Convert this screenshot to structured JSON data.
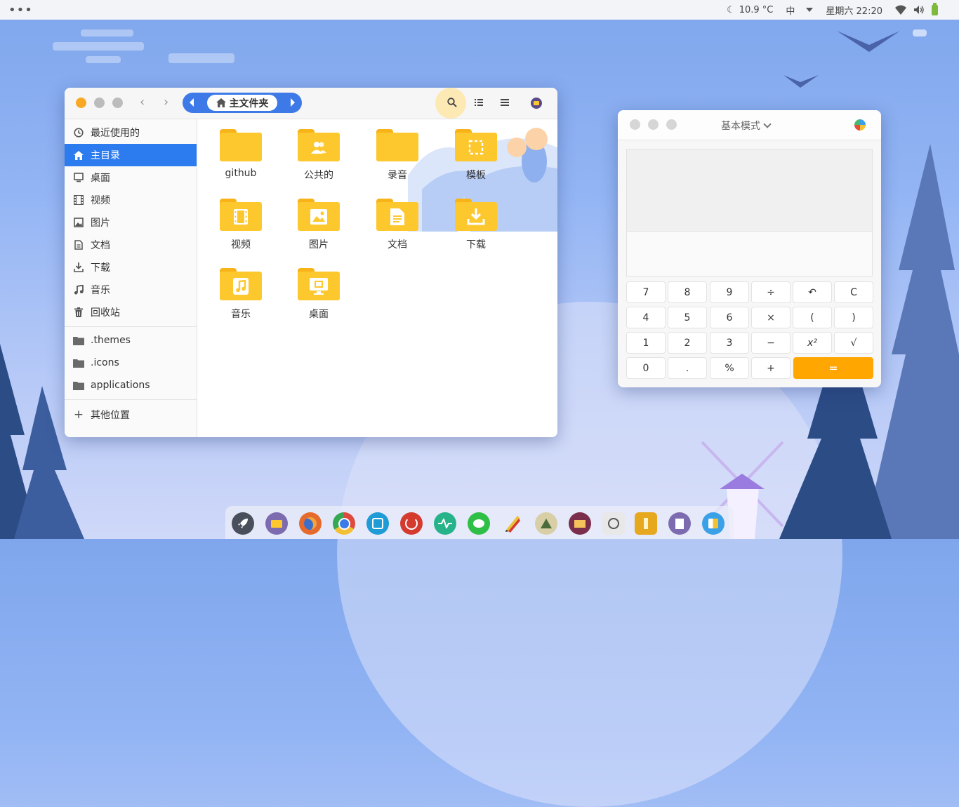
{
  "topbar": {
    "menu_dots": "•••",
    "weather": "10.9 °C",
    "input_method": "中",
    "datetime": "星期六 22:20"
  },
  "file_manager": {
    "path_crumb": "主文件夹",
    "sidebar": {
      "items": [
        {
          "label": "最近使用的",
          "icon": "clock-icon"
        },
        {
          "label": "主目录",
          "icon": "home-icon",
          "active": true
        },
        {
          "label": "桌面",
          "icon": "desktop-icon"
        },
        {
          "label": "视频",
          "icon": "film-icon"
        },
        {
          "label": "图片",
          "icon": "image-icon"
        },
        {
          "label": "文档",
          "icon": "document-icon"
        },
        {
          "label": "下载",
          "icon": "download-icon"
        },
        {
          "label": "音乐",
          "icon": "music-icon"
        },
        {
          "label": "回收站",
          "icon": "trash-icon"
        }
      ],
      "bookmarks": [
        ".themes",
        ".icons",
        "applications"
      ],
      "other_locations": "其他位置",
      "add_symbol": "+"
    },
    "folders": [
      {
        "label": "github",
        "icon": "folder-icon"
      },
      {
        "label": "公共的",
        "icon": "folder-users-icon"
      },
      {
        "label": "录音",
        "icon": "folder-icon"
      },
      {
        "label": "模板",
        "icon": "folder-template-icon"
      },
      {
        "label": "视频",
        "icon": "folder-video-icon"
      },
      {
        "label": "图片",
        "icon": "folder-pictures-icon"
      },
      {
        "label": "文档",
        "icon": "folder-documents-icon"
      },
      {
        "label": "下载",
        "icon": "folder-download-icon"
      },
      {
        "label": "音乐",
        "icon": "folder-music-icon"
      },
      {
        "label": "桌面",
        "icon": "folder-desktop-icon"
      }
    ]
  },
  "calculator": {
    "mode": "基本模式",
    "keys": [
      [
        "7",
        "8",
        "9",
        "÷",
        "↶",
        "C"
      ],
      [
        "4",
        "5",
        "6",
        "×",
        "(",
        ")"
      ],
      [
        "1",
        "2",
        "3",
        "−",
        "x²",
        "√"
      ],
      [
        "0",
        ".",
        "%",
        "+",
        "="
      ]
    ]
  },
  "dock": {
    "apps": [
      {
        "name": "launcher",
        "color": "#4a4f5c"
      },
      {
        "name": "files",
        "color": "#7d6bb0"
      },
      {
        "name": "firefox",
        "color": "#e66a2c"
      },
      {
        "name": "chrome",
        "color": "#dd4b3e"
      },
      {
        "name": "screenshot",
        "color": "#1f9bd6"
      },
      {
        "name": "netease-music",
        "color": "#d53a2f"
      },
      {
        "name": "system-monitor",
        "color": "#26b38a"
      },
      {
        "name": "wechat",
        "color": "#2fbf46"
      },
      {
        "name": "pencil",
        "color": "#e9c23a"
      },
      {
        "name": "inkscape",
        "color": "#d8cfa6"
      },
      {
        "name": "mail",
        "color": "#7b2e4c"
      },
      {
        "name": "recorder",
        "color": "#c9c9c9"
      },
      {
        "name": "archive",
        "color": "#e6a81e"
      },
      {
        "name": "text-editor",
        "color": "#7d6bb0"
      },
      {
        "name": "calculator",
        "color": "#3aa0e8"
      }
    ]
  },
  "colors": {
    "accent": "#2d7cef",
    "folder": "#fdc72e",
    "equals": "#ffa600"
  }
}
